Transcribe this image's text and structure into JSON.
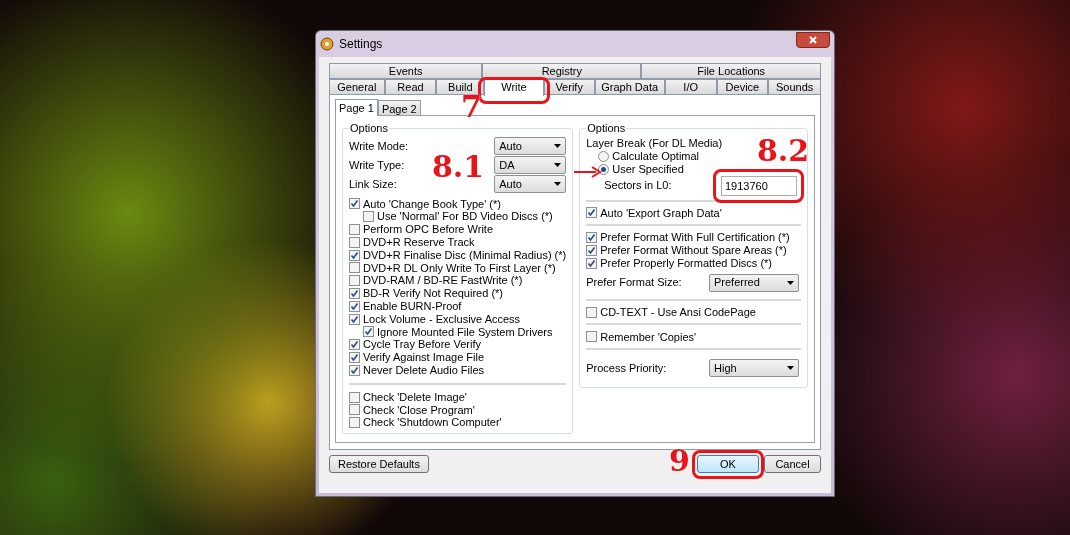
{
  "window": {
    "title": "Settings"
  },
  "tab_rows": [
    [
      {
        "label": "Events",
        "selected": false
      },
      {
        "label": "Registry",
        "selected": false
      },
      {
        "label": "File Locations",
        "selected": false
      }
    ],
    [
      {
        "label": "General",
        "selected": false
      },
      {
        "label": "Read",
        "selected": false
      },
      {
        "label": "Build",
        "selected": false
      },
      {
        "label": "Write",
        "selected": true
      },
      {
        "label": "Verify",
        "selected": false
      },
      {
        "label": "Graph Data",
        "selected": false
      },
      {
        "label": "I/O",
        "selected": false
      },
      {
        "label": "Device",
        "selected": false
      },
      {
        "label": "Sounds",
        "selected": false
      }
    ]
  ],
  "subtabs": [
    {
      "label": "Page 1",
      "selected": true
    },
    {
      "label": "Page 2",
      "selected": false
    }
  ],
  "left_group": {
    "title": "Options",
    "fields": [
      {
        "label": "Write Mode:",
        "value": "Auto"
      },
      {
        "label": "Write Type:",
        "value": "DA"
      },
      {
        "label": "Link Size:",
        "value": "Auto"
      }
    ],
    "sections": [
      [
        {
          "label": "Auto 'Change Book Type' (*)",
          "checked": true,
          "children": [
            {
              "label": "Use 'Normal' For BD Video Discs (*)",
              "checked": false
            }
          ]
        },
        {
          "label": "Perform OPC Before Write",
          "checked": false
        },
        {
          "label": "DVD+R Reserve Track",
          "checked": false
        },
        {
          "label": "DVD+R Finalise Disc (Minimal Radius) (*)",
          "checked": true
        },
        {
          "label": "DVD+R DL Only Write To First Layer (*)",
          "checked": false
        },
        {
          "label": "DVD-RAM / BD-RE FastWrite (*)",
          "checked": false
        },
        {
          "label": "BD-R Verify Not Required (*)",
          "checked": true
        },
        {
          "label": "Enable BURN-Proof",
          "checked": true
        },
        {
          "label": "Lock Volume - Exclusive Access",
          "checked": true,
          "children": [
            {
              "label": "Ignore Mounted File System Drivers",
              "checked": true
            }
          ]
        },
        {
          "label": "Cycle Tray Before Verify",
          "checked": true
        },
        {
          "label": "Verify Against Image File",
          "checked": true
        },
        {
          "label": "Never Delete Audio Files",
          "checked": true
        }
      ],
      [
        {
          "label": "Check 'Delete Image'",
          "checked": false
        },
        {
          "label": "Check 'Close Program'",
          "checked": false
        },
        {
          "label": "Check 'Shutdown Computer'",
          "checked": false
        }
      ]
    ]
  },
  "right_group": {
    "title": "Options",
    "layer_break": "Layer Break (For DL Media)",
    "radios": [
      {
        "label": "Calculate Optimal",
        "selected": false
      },
      {
        "label": "User Specified",
        "selected": true
      }
    ],
    "sectors": {
      "label": "Sectors in L0:",
      "value": "1913760"
    },
    "sections": [
      [
        {
          "kind": "checkbox",
          "label": "Auto 'Export Graph Data'",
          "checked": true
        }
      ],
      [
        {
          "kind": "checkbox",
          "label": "Prefer Format With Full Certification (*)",
          "checked": true
        },
        {
          "kind": "checkbox",
          "label": "Prefer Format Without Spare Areas (*)",
          "checked": true
        },
        {
          "kind": "checkbox",
          "label": "Prefer Properly Formatted Discs (*)",
          "checked": true
        },
        {
          "kind": "dropdown",
          "label": "Prefer Format Size:",
          "value": "Preferred"
        }
      ],
      [
        {
          "kind": "checkbox",
          "label": "CD-TEXT - Use Ansi CodePage",
          "checked": false
        }
      ],
      [
        {
          "kind": "checkbox",
          "label": "Remember 'Copies'",
          "checked": false
        }
      ],
      [
        {
          "kind": "dropdown",
          "label": "Process Priority:",
          "value": "High"
        }
      ]
    ]
  },
  "buttons": [
    {
      "label": "Restore Defaults",
      "default": false
    },
    {
      "label": "OK",
      "default": true
    },
    {
      "label": "Cancel",
      "default": false
    }
  ],
  "markers": [
    {
      "kind": "box"
    },
    {
      "kind": "label",
      "text": "7"
    },
    {
      "kind": "arrow_label",
      "text": "8.1"
    },
    {
      "kind": "label",
      "text": "8.2"
    },
    {
      "kind": "box"
    },
    {
      "kind": "label",
      "text": "9"
    },
    {
      "kind": "box"
    }
  ]
}
